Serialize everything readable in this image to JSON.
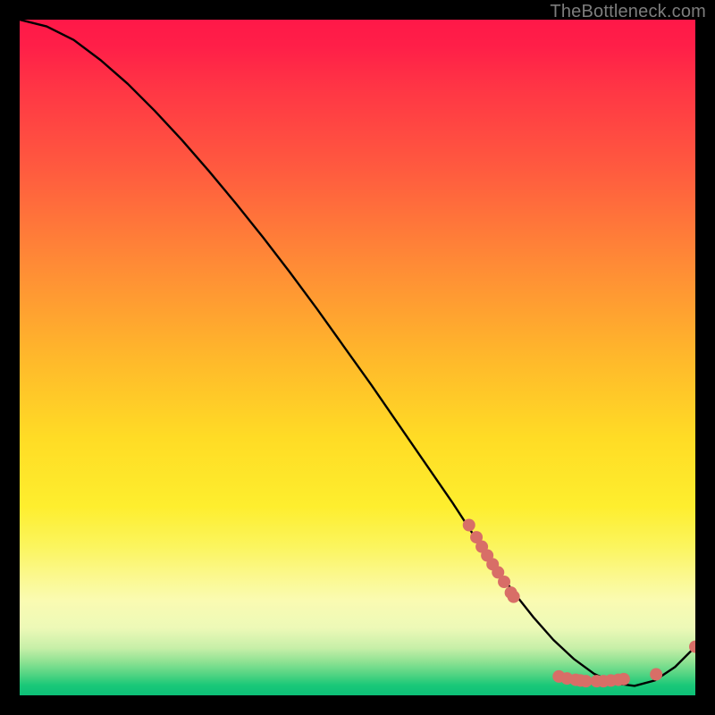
{
  "watermark": "TheBottleneck.com",
  "colors": {
    "curve": "#000000",
    "dot_fill": "#d86e67",
    "dot_stroke": "#b94f48",
    "background_black": "#000000"
  },
  "chart_data": {
    "type": "line",
    "title": "",
    "xlabel": "",
    "ylabel": "",
    "xlim": [
      0,
      100
    ],
    "ylim": [
      0,
      100
    ],
    "grid": false,
    "legend": false,
    "series": [
      {
        "name": "bottleneck-curve",
        "x": [
          0,
          4,
          8,
          12,
          16,
          20,
          24,
          28,
          32,
          36,
          40,
          44,
          48,
          52,
          56,
          60,
          64,
          67,
          70,
          73,
          76,
          79,
          82,
          85,
          88,
          91,
          94,
          97,
          100
        ],
        "y": [
          100,
          99,
          97,
          94,
          90.5,
          86.5,
          82.2,
          77.6,
          72.8,
          67.8,
          62.6,
          57.2,
          51.6,
          46,
          40.2,
          34.4,
          28.6,
          24,
          19.6,
          15.4,
          11.6,
          8.2,
          5.4,
          3.2,
          1.8,
          1.4,
          2.2,
          4.2,
          7.2
        ]
      }
    ],
    "dot_clusters": [
      {
        "name": "upper-cluster",
        "points": [
          {
            "x": 66.5,
            "y": 25.2
          },
          {
            "x": 67.6,
            "y": 23.4
          },
          {
            "x": 68.4,
            "y": 22.0
          },
          {
            "x": 69.2,
            "y": 20.7
          },
          {
            "x": 70.0,
            "y": 19.4
          },
          {
            "x": 70.8,
            "y": 18.2
          },
          {
            "x": 71.7,
            "y": 16.8
          },
          {
            "x": 72.7,
            "y": 15.2
          },
          {
            "x": 73.1,
            "y": 14.6
          }
        ]
      },
      {
        "name": "bottom-cluster",
        "points": [
          {
            "x": 79.8,
            "y": 2.8
          },
          {
            "x": 81.0,
            "y": 2.5
          },
          {
            "x": 82.3,
            "y": 2.3
          },
          {
            "x": 83.0,
            "y": 2.2
          },
          {
            "x": 83.8,
            "y": 2.1
          },
          {
            "x": 85.4,
            "y": 2.1
          },
          {
            "x": 86.4,
            "y": 2.1
          },
          {
            "x": 87.5,
            "y": 2.2
          },
          {
            "x": 88.6,
            "y": 2.3
          },
          {
            "x": 89.4,
            "y": 2.4
          },
          {
            "x": 94.2,
            "y": 3.1
          }
        ]
      },
      {
        "name": "end-point",
        "points": [
          {
            "x": 100.0,
            "y": 7.2
          }
        ]
      }
    ]
  }
}
